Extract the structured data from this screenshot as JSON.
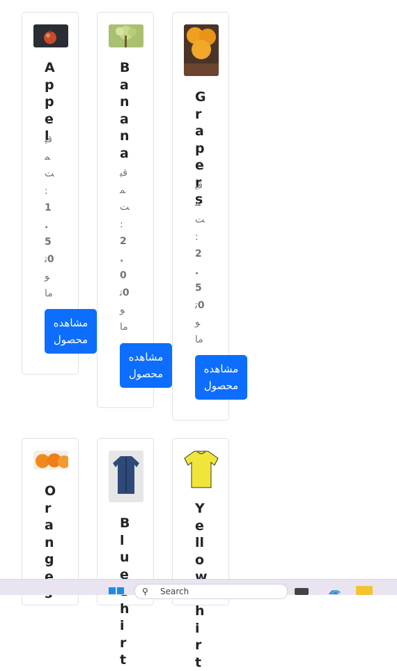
{
  "products": [
    {
      "name": "Appel",
      "price_prefix": "قیمت:",
      "price_value": "1.50",
      "price_suffix": "تومان",
      "button": "مشاهده محصول",
      "image": "apple-image"
    },
    {
      "name": "Banana",
      "price_prefix": "قیمت:",
      "price_value": "2.00",
      "price_suffix": "تومان",
      "button": "مشاهده محصول",
      "image": "banana-image"
    },
    {
      "name": "Grapers",
      "price_prefix": "قیمت:",
      "price_value": "2.50",
      "price_suffix": "تومان",
      "button": "مشاهده محصول",
      "image": "oranges-image"
    },
    {
      "name": "Oranges",
      "image": "tangerines-image"
    },
    {
      "name": "BlueShirt",
      "image": "blue-shirt-image"
    },
    {
      "name": "YellowShirt",
      "image": "yellow-shirt-image"
    }
  ],
  "taskbar": {
    "search_placeholder": "Search",
    "icons": [
      "windows-start-icon",
      "search-icon",
      "task-view-icon",
      "copilot-icon",
      "file-explorer-icon"
    ]
  },
  "colors": {
    "accent": "#0d6efd",
    "card_border": "#dee2e6",
    "text": "#212529",
    "muted": "#6c757d"
  }
}
